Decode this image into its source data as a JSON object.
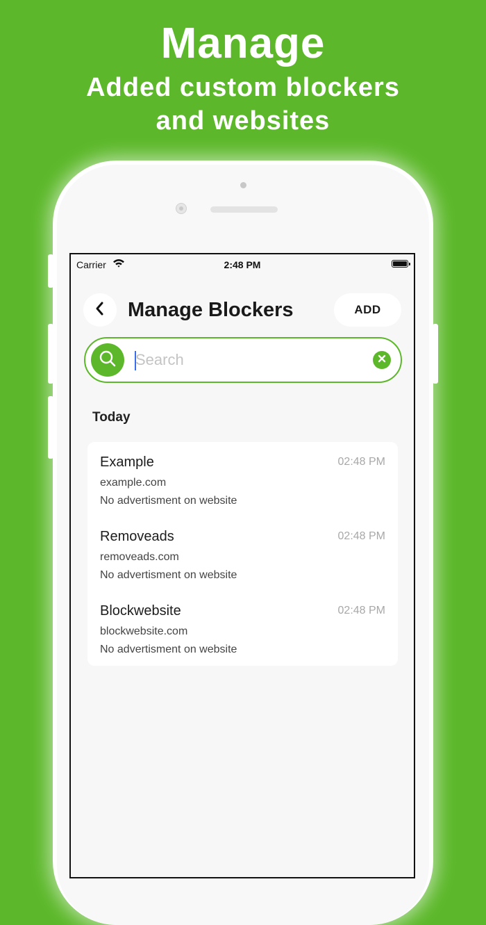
{
  "hero": {
    "title": "Manage",
    "subtitle_line1": "Added custom blockers",
    "subtitle_line2": "and websites"
  },
  "status_bar": {
    "carrier": "Carrier",
    "time": "2:48 PM"
  },
  "header": {
    "title": "Manage Blockers",
    "add_label": "ADD",
    "back_icon": "chevron-left-icon"
  },
  "search": {
    "placeholder": "Search",
    "value": "",
    "icon": "search-icon",
    "clear_icon": "close-icon"
  },
  "section": {
    "title": "Today"
  },
  "blockers": [
    {
      "name": "Example",
      "url": "example.com",
      "description": "No advertisment on website",
      "time": "02:48 PM"
    },
    {
      "name": "Removeads",
      "url": "removeads.com",
      "description": "No advertisment on website",
      "time": "02:48 PM"
    },
    {
      "name": "Blockwebsite",
      "url": "blockwebsite.com",
      "description": "No advertisment on website",
      "time": "02:48 PM"
    }
  ],
  "colors": {
    "brand_green": "#5cb82a",
    "screen_bg": "#f7f7f7",
    "card_bg": "#ffffff",
    "time_gray": "#a8a8a8"
  }
}
